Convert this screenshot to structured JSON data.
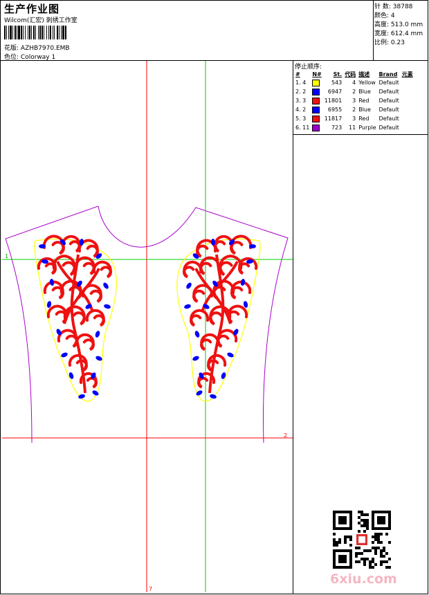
{
  "header": {
    "title": "生产作业图",
    "subtitle": "Wilcom(汇宏) 刺绣工作室",
    "design_label": "花版:",
    "design_value": "AZHB7970.EMB",
    "colorway_label": "色位:",
    "colorway_value": "Colorway 1"
  },
  "stats": {
    "stitches_label": "针 数:",
    "stitches_value": "38788",
    "colors_label": "颜色:",
    "colors_value": "4",
    "height_label": "高度:",
    "height_value": "513.0 mm",
    "width_label": "宽度:",
    "width_value": "612.4 mm",
    "scale_label": "比例:",
    "scale_value": "0.23"
  },
  "sequence": {
    "title": "停止顺序:",
    "headers": [
      "#",
      "N#",
      "St.",
      "代码",
      "描述",
      "Brand",
      "元素"
    ],
    "rows": [
      {
        "idx": "1. 4",
        "color": "#ffff00",
        "st": "543",
        "code": "4",
        "desc": "Yellow",
        "brand": "Default"
      },
      {
        "idx": "2. 2",
        "color": "#0000ff",
        "st": "6947",
        "code": "2",
        "desc": "Blue",
        "brand": "Default"
      },
      {
        "idx": "3. 3",
        "color": "#ee1111",
        "st": "11801",
        "code": "3",
        "desc": "Red",
        "brand": "Default"
      },
      {
        "idx": "4. 2",
        "color": "#0000ff",
        "st": "6955",
        "code": "2",
        "desc": "Blue",
        "brand": "Default"
      },
      {
        "idx": "5. 3",
        "color": "#ee1111",
        "st": "11817",
        "code": "3",
        "desc": "Red",
        "brand": "Default"
      },
      {
        "idx": "6. 11",
        "color": "#9900cc",
        "st": "723",
        "code": "11",
        "desc": "Purple",
        "brand": "Default"
      }
    ]
  },
  "guides": {
    "label_1": "1",
    "label_2": "2",
    "label_bottom": "7"
  },
  "watermark": "6xiu.com",
  "colors": {
    "red_guide": "#ff0000",
    "green_guide": "#00cc00",
    "outline": "#aa00cc",
    "border": "#ffff00",
    "blue": "#0000ff",
    "red": "#ee1111"
  }
}
